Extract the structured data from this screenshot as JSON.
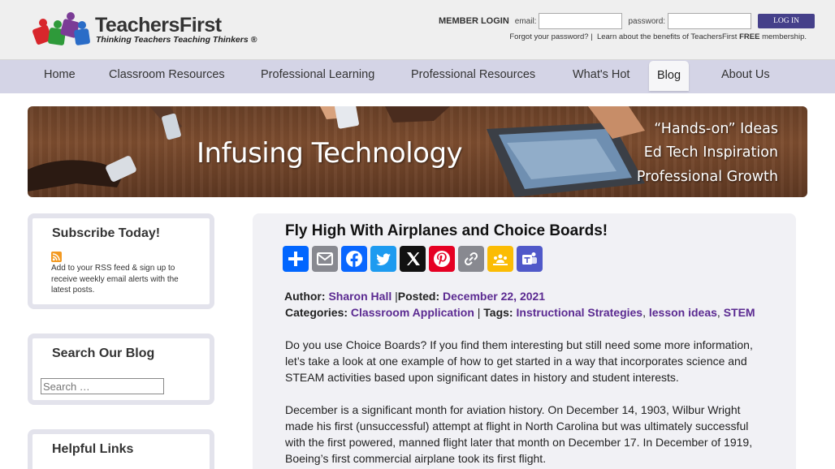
{
  "brand": {
    "name": "TeachersFirst",
    "tagline": "Thinking Teachers Teaching Thinkers ®"
  },
  "login": {
    "title": "MEMBER LOGIN",
    "email_label": "email:",
    "password_label": "password:",
    "button": "LOG IN",
    "forgot": "Forgot your password?",
    "sep": "|",
    "learn_prefix": "Learn about the benefits of TeachersFirst",
    "learn_free": "FREE",
    "learn_suffix": "membership."
  },
  "nav": {
    "items": [
      "Home",
      "Classroom Resources",
      "Professional Learning",
      "Professional Resources",
      "What's Hot",
      "Blog",
      "About Us"
    ],
    "active": "Blog"
  },
  "banner": {
    "title": "Infusing Technology",
    "lines": [
      "“Hands-on” Ideas",
      "Ed Tech Inspiration",
      "Professional Growth"
    ]
  },
  "sidebar": {
    "subscribe_title": "Subscribe Today!",
    "subscribe_text": "Add to your RSS feed & sign up to receive weekly email alerts with the latest posts.",
    "search_title": "Search Our Blog",
    "search_placeholder": "Search …",
    "links_title": "Helpful Links"
  },
  "post": {
    "title": "Fly High With Airplanes and Choice Boards!",
    "share_icons": [
      "share-icon",
      "email-icon",
      "facebook-icon",
      "twitter-x-icon",
      "pinterest-icon",
      "copy-link-icon",
      "google-classroom-icon",
      "microsoft-teams-icon"
    ],
    "author_label": "Author:",
    "author": "Sharon Hall",
    "posted_label": "Posted:",
    "posted": "December 22, 2021",
    "categories_label": "Categories:",
    "category": "Classroom Application",
    "tags_label": "Tags:",
    "tags": [
      "Instructional Strategies",
      "lesson ideas",
      "STEM"
    ],
    "meta_sep": "|",
    "tag_sep": ",",
    "paragraphs": [
      "Do you use Choice Boards? If you find them interesting but still need some more information, let’s take a look at one example of how to get started in a way that incorporates science and STEAM activities based upon significant dates in history and student interests.",
      "December is a significant month for aviation history. On December 14, 1903, Wilbur Wright made his first (unsuccessful) attempt at flight in North Carolina but was ultimately successful with the first powered, manned flight later that month on December 17. In December of 1919, Boeing’s first commercial airplane took its first flight."
    ]
  }
}
